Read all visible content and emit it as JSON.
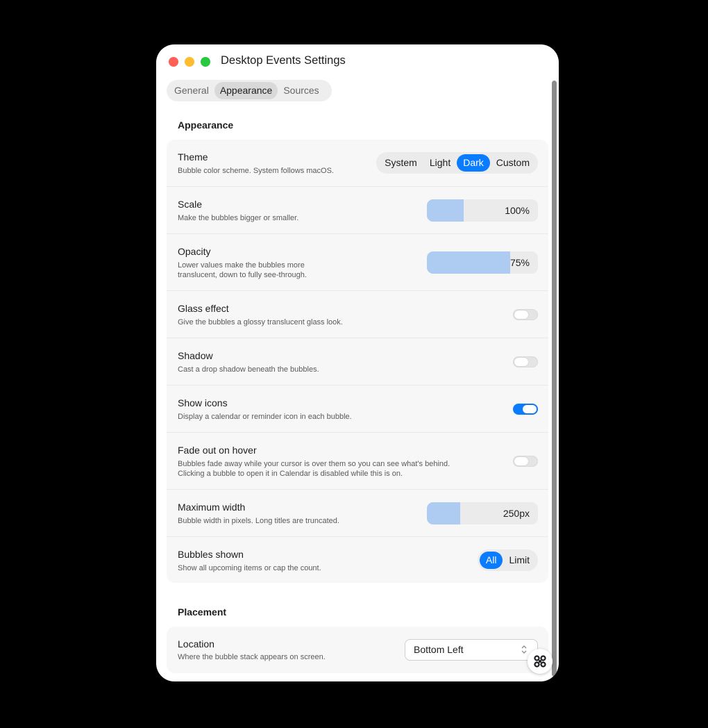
{
  "window": {
    "title": "Desktop Events Settings"
  },
  "tabs": [
    {
      "label": "General",
      "active": false
    },
    {
      "label": "Appearance",
      "active": true
    },
    {
      "label": "Sources",
      "active": false
    }
  ],
  "appearance": {
    "heading": "Appearance",
    "theme": {
      "title": "Theme",
      "desc": "Bubble color scheme. System follows macOS.",
      "options": [
        "System",
        "Light",
        "Dark",
        "Custom"
      ],
      "selected": "Dark"
    },
    "scale": {
      "title": "Scale",
      "desc": "Make the bubbles bigger or smaller.",
      "value_text": "100%",
      "level": 0.33
    },
    "opacity": {
      "title": "Opacity",
      "desc_line1": "Lower values make the bubbles more",
      "desc_line2": "translucent, down to fully see-through.",
      "value_text": "75%",
      "level": 0.75
    },
    "glass": {
      "title": "Glass effect",
      "desc": "Give the bubbles a glossy translucent glass look.",
      "on": false
    },
    "shadow": {
      "title": "Shadow",
      "desc": "Cast a drop shadow beneath the bubbles.",
      "on": false
    },
    "show_icons": {
      "title": "Show icons",
      "desc": "Display a calendar or reminder icon in each bubble.",
      "on": true
    },
    "fade": {
      "title": "Fade out on hover",
      "desc_line1": "Bubbles fade away while your cursor is over them so you can see what's behind.",
      "desc_line2": "Clicking a bubble to open it in Calendar is disabled while this is on.",
      "on": false
    },
    "max_width": {
      "title": "Maximum width",
      "desc": "Bubble width in pixels. Long titles are truncated.",
      "value_text": "250px",
      "level": 0.3
    },
    "bubbles_shown": {
      "title": "Bubbles shown",
      "desc": "Show all upcoming items or cap the count.",
      "options": [
        "All",
        "Limit"
      ],
      "selected": "All"
    }
  },
  "placement": {
    "heading": "Placement",
    "location": {
      "title": "Location",
      "desc": "Where the bubble stack appears on screen.",
      "value": "Bottom Left"
    }
  },
  "colors": {
    "accent": "#0a7cff",
    "slider_fill": "#aecbf1",
    "window_bg": "#ffffff",
    "card_bg": "#f7f7f7"
  },
  "icons": {
    "fab": "command-key-icon",
    "select": "chevron-up-down-icon"
  }
}
